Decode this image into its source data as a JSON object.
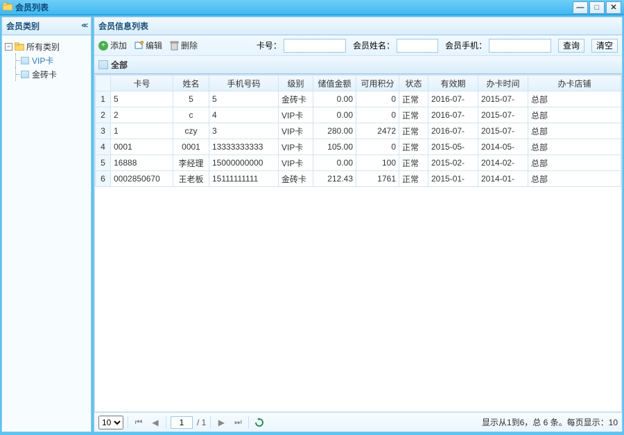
{
  "window": {
    "title": "会员列表"
  },
  "sidebar": {
    "header": "会员类别",
    "root": "所有类别",
    "items": [
      {
        "label": "VIP卡"
      },
      {
        "label": "金砖卡"
      }
    ]
  },
  "main": {
    "header": "会员信息列表",
    "toolbar": {
      "add": "添加",
      "edit": "编辑",
      "delete": "删除",
      "card_label": "卡号：",
      "name_label": "会员姓名：",
      "phone_label": "会员手机：",
      "query": "查询",
      "clear": "清空",
      "card_value": "",
      "name_value": "",
      "phone_value": ""
    },
    "grid_title": "全部",
    "columns": {
      "card": "卡号",
      "name": "姓名",
      "phone": "手机号码",
      "level": "级别",
      "amount": "储值金额",
      "points": "可用积分",
      "status": "状态",
      "valid": "有效期",
      "open_time": "办卡时间",
      "shop": "办卡店铺"
    },
    "rows": [
      {
        "idx": "1",
        "card": "5",
        "name": "5",
        "phone": "5",
        "level": "金砖卡",
        "amount": "0.00",
        "points": "0",
        "status": "正常",
        "valid": "2016-07-",
        "open": "2015-07-",
        "shop": "总部"
      },
      {
        "idx": "2",
        "card": "2",
        "name": "c",
        "phone": "4",
        "level": "VIP卡",
        "amount": "0.00",
        "points": "0",
        "status": "正常",
        "valid": "2016-07-",
        "open": "2015-07-",
        "shop": "总部"
      },
      {
        "idx": "3",
        "card": "1",
        "name": "czy",
        "phone": "3",
        "level": "VIP卡",
        "amount": "280.00",
        "points": "2472",
        "status": "正常",
        "valid": "2016-07-",
        "open": "2015-07-",
        "shop": "总部"
      },
      {
        "idx": "4",
        "card": "0001",
        "name": "0001",
        "phone": "13333333333",
        "level": "VIP卡",
        "amount": "105.00",
        "points": "0",
        "status": "正常",
        "valid": "2015-05-",
        "open": "2014-05-",
        "shop": "总部"
      },
      {
        "idx": "5",
        "card": "16888",
        "name": "李经理",
        "phone": "15000000000",
        "level": "VIP卡",
        "amount": "0.00",
        "points": "100",
        "status": "正常",
        "valid": "2015-02-",
        "open": "2014-02-",
        "shop": "总部"
      },
      {
        "idx": "6",
        "card": "0002850670",
        "name": "王老板",
        "phone": "15111111111",
        "level": "金砖卡",
        "amount": "212.43",
        "points": "1761",
        "status": "正常",
        "valid": "2015-01-",
        "open": "2014-01-",
        "shop": "总部"
      }
    ]
  },
  "pager": {
    "page_size": "10",
    "current": "1",
    "total_pages_label": "/ 1",
    "status": "显示从1到6，总 6 条。每页显示：10"
  }
}
